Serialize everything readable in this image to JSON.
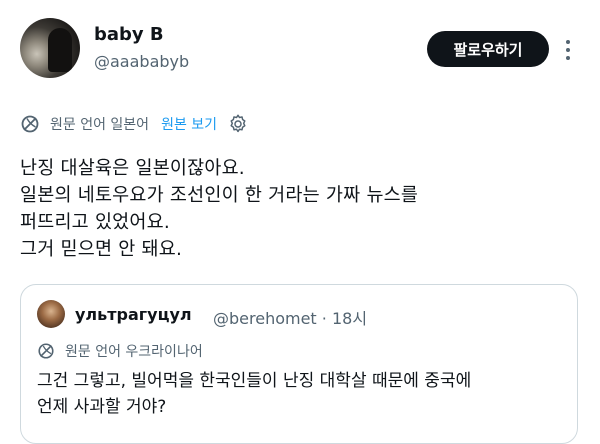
{
  "author": {
    "name": "baby B",
    "handle": "@aaababyb"
  },
  "follow_label": "팔로우하기",
  "more_icon": "more-vertical-icon",
  "translation": {
    "icon": "translate-icon",
    "label": "원문 언어 일본어",
    "show_original": "원본 보기",
    "settings_icon": "gear-icon"
  },
  "post": {
    "lines": [
      "난징 대살육은 일본이잖아요.",
      "일본의 네토우요가 조선인이 한 거라는 가짜 뉴스를",
      "퍼뜨리고 있었어요.",
      "그거 믿으면 안 돼요."
    ]
  },
  "quote": {
    "name": "ультрагуцул",
    "handle_time": "@berehomet · 18시",
    "translation_label": "원문 언어 우크라이나어",
    "lines": [
      "그건 그렇고, 빌어먹을 한국인들이 난징 대학살 때문에 중국에",
      "언제 사과할 거야?"
    ]
  },
  "colors": {
    "text": "#0f1419",
    "muted": "#536471",
    "link": "#1d9bf0",
    "button_bg": "#0f1419",
    "border": "#cfd9de"
  }
}
